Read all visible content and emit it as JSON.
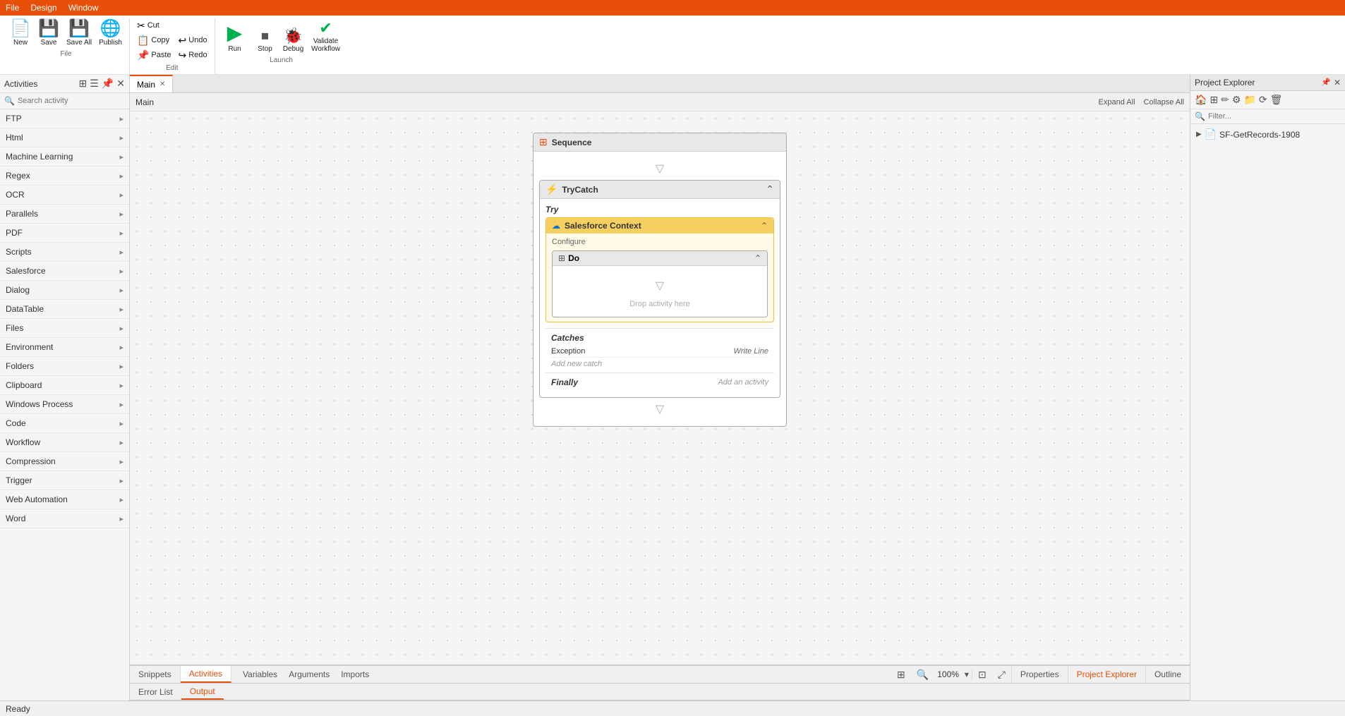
{
  "menu": {
    "items": [
      "File",
      "Design",
      "Window"
    ]
  },
  "ribbon": {
    "file_group": {
      "label": "File",
      "buttons": [
        {
          "id": "new",
          "icon": "📄",
          "label": "New"
        },
        {
          "id": "save",
          "icon": "💾",
          "label": "Save"
        },
        {
          "id": "save-all",
          "icon": "💾",
          "label": "Save All"
        },
        {
          "id": "publish",
          "icon": "🌐",
          "label": "Publish"
        }
      ]
    },
    "edit_group": {
      "label": "Edit",
      "small_buttons": [
        {
          "id": "cut",
          "icon": "✂",
          "label": "Cut"
        },
        {
          "id": "undo",
          "icon": "↩",
          "label": "Undo"
        },
        {
          "id": "copy",
          "icon": "📋",
          "label": "Copy"
        },
        {
          "id": "redo",
          "icon": "↪",
          "label": "Redo"
        },
        {
          "id": "paste",
          "icon": "📌",
          "label": "Paste"
        }
      ]
    },
    "launch_group": {
      "label": "Launch",
      "buttons": [
        {
          "id": "run",
          "icon": "▶",
          "label": "Run"
        },
        {
          "id": "stop",
          "icon": "⏹",
          "label": "Stop"
        },
        {
          "id": "debug",
          "icon": "🐞",
          "label": "Debug"
        },
        {
          "id": "validate",
          "icon": "✔",
          "label": "Validate\nWorkflow"
        }
      ]
    }
  },
  "activities_panel": {
    "title": "Activities",
    "search_placeholder": "Search activity",
    "items": [
      {
        "name": "FTP",
        "expanded": false
      },
      {
        "name": "Html",
        "expanded": false
      },
      {
        "name": "Machine Learning",
        "expanded": false
      },
      {
        "name": "Regex",
        "expanded": false
      },
      {
        "name": "OCR",
        "expanded": false
      },
      {
        "name": "Parallels",
        "expanded": false
      },
      {
        "name": "PDF",
        "expanded": false
      },
      {
        "name": "Scripts",
        "expanded": false
      },
      {
        "name": "Salesforce",
        "expanded": false
      },
      {
        "name": "Dialog",
        "expanded": false
      },
      {
        "name": "DataTable",
        "expanded": false
      },
      {
        "name": "Files",
        "expanded": false
      },
      {
        "name": "Environment",
        "expanded": false
      },
      {
        "name": "Folders",
        "expanded": false
      },
      {
        "name": "Clipboard",
        "expanded": false
      },
      {
        "name": "Windows Process",
        "expanded": false
      },
      {
        "name": "Code",
        "expanded": false
      },
      {
        "name": "Workflow",
        "expanded": false
      },
      {
        "name": "Compression",
        "expanded": false
      },
      {
        "name": "Trigger",
        "expanded": false
      },
      {
        "name": "Web Automation",
        "expanded": false
      },
      {
        "name": "Word",
        "expanded": false
      }
    ]
  },
  "tab_bar": {
    "tabs": [
      {
        "id": "main",
        "label": "Main",
        "active": true,
        "closeable": true
      }
    ],
    "breadcrumb": "Main",
    "expand_all": "Expand All",
    "collapse_all": "Collapse All"
  },
  "canvas": {
    "sequence": {
      "title": "Sequence",
      "trycatch": {
        "title": "TryCatch",
        "try_label": "Try",
        "salesforce_ctx": {
          "title": "Salesforce Context",
          "configure": "Configure",
          "do": {
            "title": "Do",
            "drop_text": "Drop activity here"
          }
        },
        "catches_label": "Catches",
        "exception_label": "Exception",
        "write_line": "Write Line",
        "add_catch": "Add new catch",
        "finally_label": "Finally",
        "add_activity": "Add an activity"
      }
    }
  },
  "project_explorer": {
    "title": "Project Explorer",
    "filter_placeholder": "Filter...",
    "files": [
      {
        "name": "SF-GetRecords-1908",
        "icon": "📄",
        "type": "file"
      }
    ]
  },
  "bottom_tabs": {
    "left_tabs": [
      {
        "id": "snippets",
        "label": "Snippets"
      },
      {
        "id": "activities",
        "label": "Activities",
        "active": true
      }
    ],
    "panel_tabs": [
      {
        "id": "variables",
        "label": "Variables"
      },
      {
        "id": "arguments",
        "label": "Arguments"
      },
      {
        "id": "imports",
        "label": "Imports"
      }
    ],
    "right_tabs": [
      {
        "id": "properties",
        "label": "Properties"
      },
      {
        "id": "project-explorer",
        "label": "Project Explorer",
        "active": true
      },
      {
        "id": "outline",
        "label": "Outline"
      }
    ],
    "zoom": "100%"
  },
  "status_tabs": {
    "tabs": [
      {
        "id": "error-list",
        "label": "Error List"
      },
      {
        "id": "output",
        "label": "Output"
      }
    ]
  },
  "status_bar": {
    "text": "Ready"
  }
}
